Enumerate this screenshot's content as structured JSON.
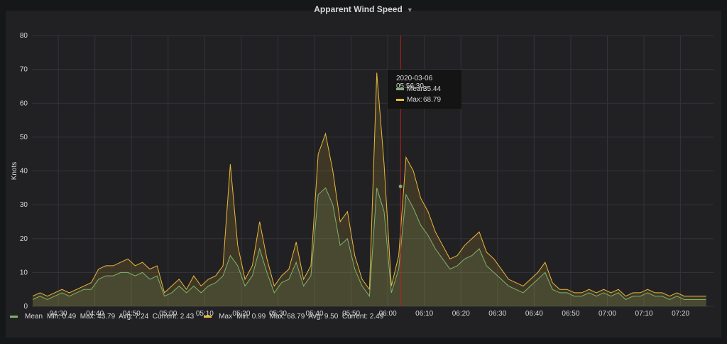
{
  "chart_data": {
    "type": "line",
    "title": "Apparent Wind Speed",
    "ylabel": "Knots",
    "xlabel": "",
    "ylim": [
      0,
      80
    ],
    "yticks": [
      0,
      10,
      20,
      30,
      40,
      50,
      60,
      70,
      80
    ],
    "xlim_minutes": [
      -7.2,
      179
    ],
    "xtick_labels": [
      "04:30",
      "04:40",
      "04:50",
      "05:00",
      "05:10",
      "05:20",
      "05:30",
      "05:40",
      "05:50",
      "06:00",
      "06:10",
      "06:20",
      "06:30",
      "06:40",
      "06:50",
      "07:00",
      "07:10",
      "07:20"
    ],
    "x_start": "04:23",
    "x_step_minutes": 2,
    "series": [
      {
        "name": "Mean",
        "color": "#7eb26d",
        "values": [
          2,
          3,
          2,
          3,
          4,
          3,
          4,
          5,
          5,
          8,
          9,
          9,
          10,
          10,
          9,
          10,
          8,
          9,
          3,
          4,
          6,
          4,
          6,
          4,
          6,
          7,
          9,
          15,
          12,
          6,
          9,
          17,
          10,
          4,
          7,
          8,
          13,
          6,
          9,
          33,
          35,
          30,
          18,
          20,
          11,
          6,
          3,
          35,
          28,
          4,
          11,
          33,
          29,
          24,
          21,
          17,
          14,
          11,
          12,
          14,
          15,
          17,
          12,
          10,
          8,
          6,
          5,
          4,
          6,
          8,
          10,
          5,
          4,
          4,
          3,
          3,
          4,
          3,
          4,
          3,
          4,
          2,
          3,
          3,
          4,
          3,
          3,
          2,
          3,
          2,
          2,
          2,
          2
        ],
        "min": 0.49,
        "max": 43.79,
        "avg": 7.24,
        "current": 2.43
      },
      {
        "name": "Max",
        "color": "#eab839",
        "values": [
          3,
          4,
          3,
          4,
          5,
          4,
          5,
          6,
          7,
          11,
          12,
          12,
          13,
          14,
          12,
          13,
          11,
          12,
          4,
          6,
          8,
          5,
          9,
          6,
          8,
          9,
          12,
          42,
          18,
          8,
          12,
          25,
          14,
          6,
          9,
          11,
          19,
          8,
          12,
          45,
          51,
          40,
          25,
          28,
          15,
          8,
          5,
          69,
          42,
          6,
          15,
          44,
          40,
          32,
          28,
          22,
          18,
          14,
          15,
          18,
          20,
          22,
          16,
          14,
          11,
          8,
          7,
          6,
          8,
          10,
          13,
          7,
          5,
          5,
          4,
          4,
          5,
          4,
          5,
          4,
          5,
          3,
          4,
          4,
          5,
          4,
          4,
          3,
          4,
          3,
          3,
          3,
          3
        ],
        "min": 0.99,
        "max": 68.79,
        "avg": 9.5,
        "current": 2.49
      }
    ],
    "legend_placement": "bottom-left"
  },
  "legend": [
    {
      "name": "Mean",
      "stats": "Min: 0.49  Max: 43.79  Avg: 7.24  Current: 2.43"
    },
    {
      "name": "Max",
      "stats": "Min: 0.99  Max: 68.79  Avg: 9.50  Current: 2.49"
    }
  ],
  "tooltip": {
    "time": "2020-03-06 05:56:30",
    "rows": [
      {
        "label": "Mean:",
        "value": "35.44",
        "color": "#7eb26d"
      },
      {
        "label": "Max:",
        "value": "68.79",
        "color": "#eab839"
      }
    ],
    "cursor_minutes": 93.5
  }
}
